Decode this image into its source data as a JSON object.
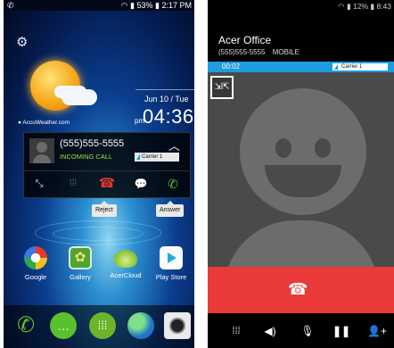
{
  "left_phone": {
    "status": {
      "left_icon": "phone-icon",
      "battery": "53%",
      "time": "2:17 PM"
    },
    "weather": {
      "source": "AccuWeather.com",
      "date": "Jun 10 / Tue",
      "time": "04:36",
      "ampm": "pm"
    },
    "incoming_call": {
      "number": "(555)555-5555",
      "status": "INCOMING CALL",
      "carrier": "Carrier 1",
      "tooltips": {
        "reject": "Reject",
        "answer": "Answer"
      }
    },
    "apps": [
      {
        "label": "Google",
        "icon": "google-icon"
      },
      {
        "label": "Gallery",
        "icon": "gallery-icon"
      },
      {
        "label": "AcerCloud",
        "icon": "acercloud-icon"
      },
      {
        "label": "Play Store",
        "icon": "play-store-icon"
      }
    ],
    "dock": [
      "phone-icon",
      "messaging-icon",
      "apps-icon",
      "browser-icon",
      "camera-icon"
    ]
  },
  "right_phone": {
    "status": {
      "battery": "12%",
      "time": "8:43"
    },
    "caller_name": "Acer Office",
    "number": "(555)555-5555",
    "number_type": "MOBILE",
    "timer": "00:02",
    "carrier": "Carrier 1"
  },
  "colors": {
    "answer_green": "#5ac12d",
    "reject_red": "#e1362f",
    "timer_blue": "#1f9be2",
    "endcall_red": "#ea3a3a"
  }
}
